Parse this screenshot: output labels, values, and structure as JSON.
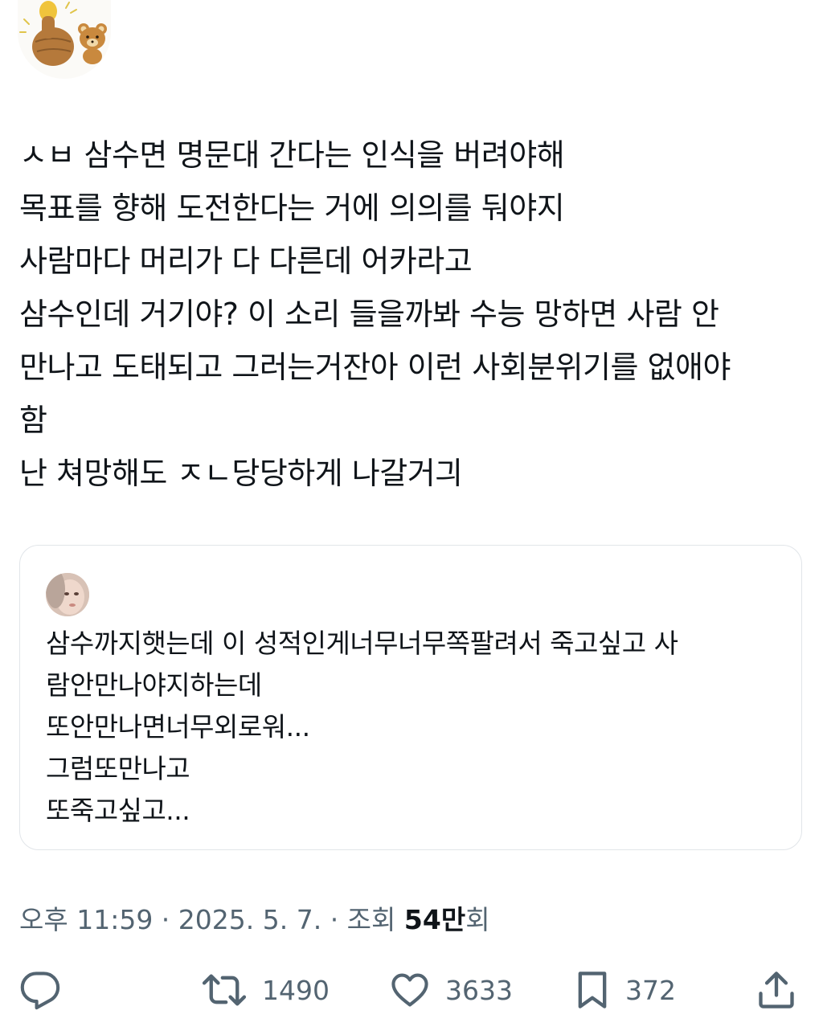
{
  "tweet": {
    "lines": [
      "ㅅㅂ 삼수면 명문대 간다는 인식을 버려야해",
      "목표를 향해 도전한다는 거에 의의를 둬야지",
      "사람마다 머리가 다 다른데 어카라고",
      "삼수인데 거기야? 이 소리 들을까봐 수능 망하면 사람 안",
      "만나고 도태되고 그러는거잔아 이런 사회분위기를 없애야",
      "함",
      "난 쳐망해도 ㅈㄴ당당하게 나갈거긔"
    ]
  },
  "quote": {
    "lines": [
      "삼수까지햇는데 이 성적인게너무너무쪽팔려서 죽고싶고 사",
      "람안만나야지하는데",
      "또안만나면너무외로워...",
      "그럼또만나고",
      "또죽고싶고..."
    ]
  },
  "meta": {
    "prefix": "오후 11:59 · 2025. 5. 7. · 조회 ",
    "views": "54만",
    "suffix": "회"
  },
  "actions": {
    "reply_icon": "reply-icon",
    "retweet_icon": "retweet-icon",
    "retweets": "1490",
    "like_icon": "heart-icon",
    "likes": "3633",
    "bookmark_icon": "bookmark-icon",
    "bookmarks": "372",
    "share_icon": "share-icon"
  },
  "colors": {
    "text": "#0f1419",
    "secondary": "#536471",
    "border": "#e1e5e9"
  }
}
